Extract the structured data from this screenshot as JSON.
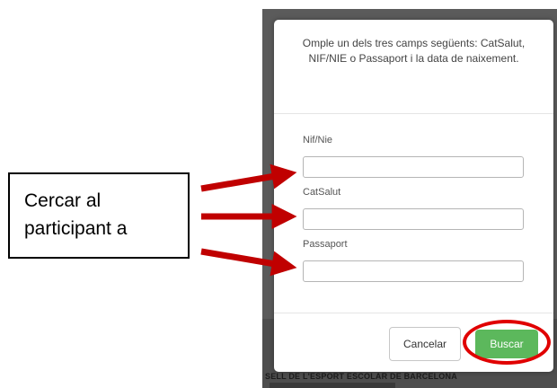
{
  "modal": {
    "instruction": "Omple un dels tres camps següents: CatSalut, NIF/NIE o Passaport i la data de naixement.",
    "fields": [
      {
        "label": "Nif/Nie",
        "value": ""
      },
      {
        "label": "CatSalut",
        "value": ""
      },
      {
        "label": "Passaport",
        "value": ""
      }
    ],
    "cancel_label": "Cancelar",
    "search_label": "Buscar"
  },
  "background": {
    "footer_text": "SELL DE L'ESPORT ESCOLAR DE BARCELONA"
  },
  "annotation": {
    "line1": "Cercar al",
    "line2": "participant a",
    "arrow_color": "#c00000",
    "highlight_color": "#e00000"
  },
  "colors": {
    "search_button": "#5cb85c"
  }
}
